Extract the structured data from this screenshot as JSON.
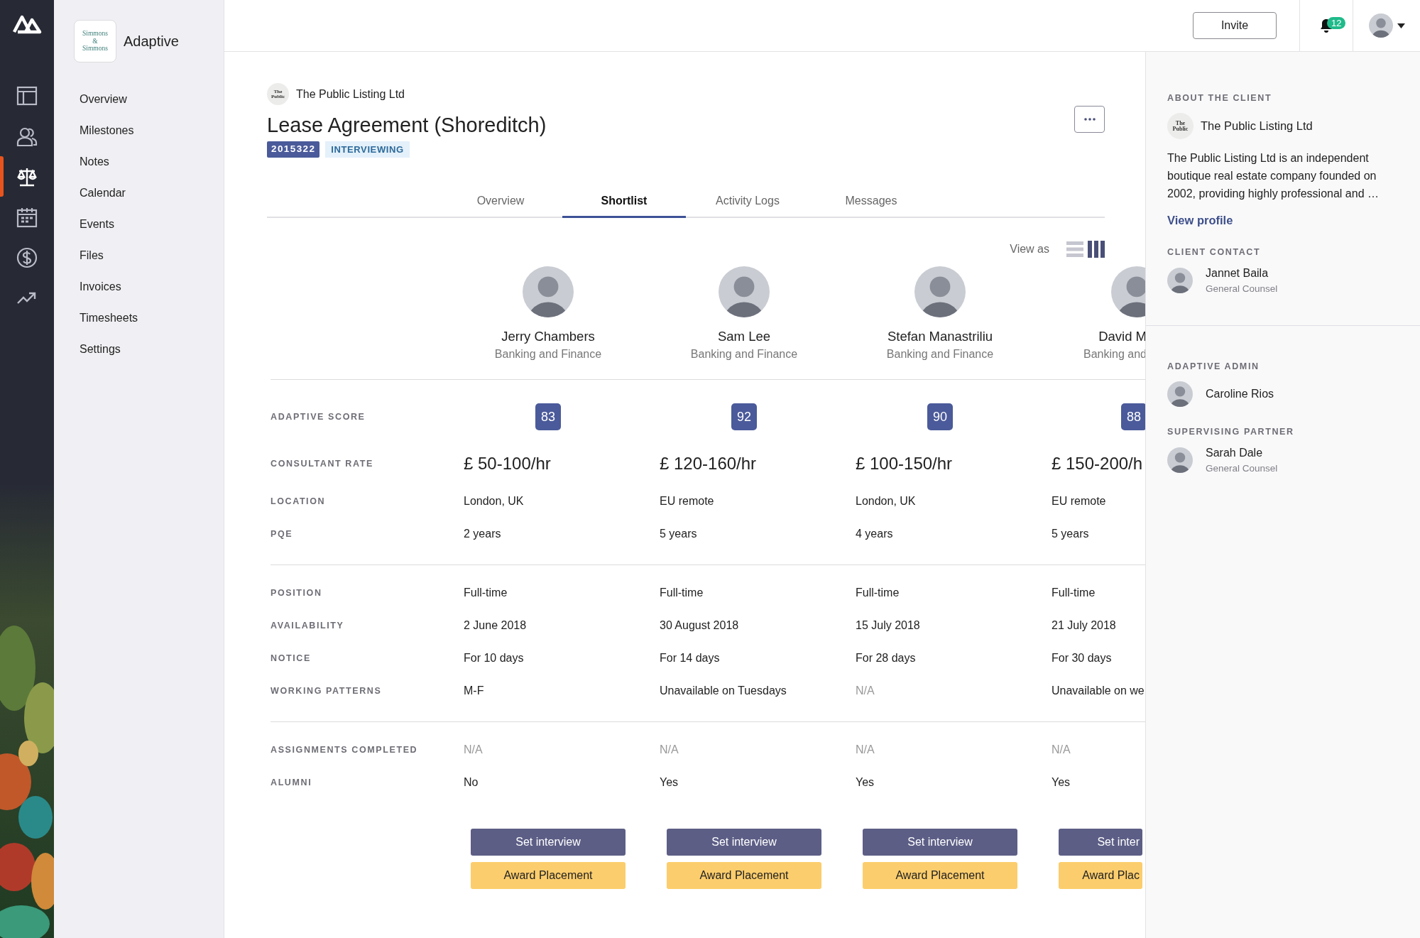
{
  "rail": {
    "items": [
      {
        "kind": "layout",
        "selected": false
      },
      {
        "kind": "people",
        "selected": false
      },
      {
        "kind": "scales",
        "selected": true
      },
      {
        "kind": "calendar",
        "selected": false
      },
      {
        "kind": "dollar",
        "selected": false
      },
      {
        "kind": "trend",
        "selected": false
      }
    ]
  },
  "sidebar": {
    "logo_text": "Simmons & Simmons",
    "org": "Adaptive",
    "items": [
      {
        "label": "Overview"
      },
      {
        "label": "Milestones"
      },
      {
        "label": "Notes"
      },
      {
        "label": "Calendar"
      },
      {
        "label": "Events"
      },
      {
        "label": "Files"
      },
      {
        "label": "Invoices"
      },
      {
        "label": "Timesheets"
      },
      {
        "label": "Settings"
      }
    ]
  },
  "topbar": {
    "invite": "Invite",
    "notifications": "12"
  },
  "header": {
    "client_logo_text": "The Public",
    "client": "The Public Listing Ltd",
    "title": "Lease Agreement (Shoreditch)",
    "id": "2015322",
    "status": "INTERVIEWING"
  },
  "tabs": [
    {
      "label": "Overview",
      "selected": false
    },
    {
      "label": "Shortlist",
      "selected": true
    },
    {
      "label": "Activity Logs",
      "selected": false
    },
    {
      "label": "Messages",
      "selected": false
    }
  ],
  "view_as": {
    "label": "View as",
    "options": [
      {
        "kind": "list",
        "selected": false
      },
      {
        "kind": "columns",
        "selected": true
      }
    ]
  },
  "candidates": [
    {
      "name": "Jerry Chambers",
      "practice": "Banking and Finance"
    },
    {
      "name": "Sam Lee",
      "practice": "Banking and Finance"
    },
    {
      "name": "Stefan Manastriliu",
      "practice": "Banking and Finance"
    },
    {
      "name": "David M",
      "practice": "Banking and"
    }
  ],
  "sections": [
    {
      "rows": [
        {
          "label": "ADAPTIVE SCORE",
          "kind": "score",
          "values": [
            {
              "text": "83"
            },
            {
              "text": "92"
            },
            {
              "text": "90"
            },
            {
              "text": "88"
            }
          ]
        },
        {
          "label": "CONSULTANT RATE",
          "kind": "rate",
          "values": [
            {
              "text": "£ 50-100/hr",
              "muted": false
            },
            {
              "text": "£ 120-160/hr",
              "muted": false
            },
            {
              "text": "£ 100-150/hr",
              "muted": false
            },
            {
              "text": "£ 150-200/h",
              "muted": false
            }
          ]
        },
        {
          "label": "LOCATION",
          "kind": "text",
          "values": [
            {
              "text": "London, UK",
              "muted": false
            },
            {
              "text": "EU remote",
              "muted": false
            },
            {
              "text": "London, UK",
              "muted": false
            },
            {
              "text": "EU remote",
              "muted": false
            }
          ]
        },
        {
          "label": "PQE",
          "kind": "text",
          "values": [
            {
              "text": "2 years",
              "muted": false
            },
            {
              "text": "5 years",
              "muted": false
            },
            {
              "text": "4 years",
              "muted": false
            },
            {
              "text": "5 years",
              "muted": false
            }
          ]
        }
      ]
    },
    {
      "rows": [
        {
          "label": "POSITION",
          "kind": "text",
          "values": [
            {
              "text": "Full-time",
              "muted": false
            },
            {
              "text": "Full-time",
              "muted": false
            },
            {
              "text": "Full-time",
              "muted": false
            },
            {
              "text": "Full-time",
              "muted": false
            }
          ]
        },
        {
          "label": "AVAILABILITY",
          "kind": "text",
          "values": [
            {
              "text": "2 June 2018",
              "muted": false
            },
            {
              "text": "30 August 2018",
              "muted": false
            },
            {
              "text": "15 July 2018",
              "muted": false
            },
            {
              "text": "21 July 2018",
              "muted": false
            }
          ]
        },
        {
          "label": "NOTICE",
          "kind": "text",
          "values": [
            {
              "text": "For 10 days",
              "muted": false
            },
            {
              "text": "For 14 days",
              "muted": false
            },
            {
              "text": "For 28 days",
              "muted": false
            },
            {
              "text": "For 30 days",
              "muted": false
            }
          ]
        },
        {
          "label": "WORKING PATTERNS",
          "kind": "text",
          "values": [
            {
              "text": "M-F",
              "muted": false
            },
            {
              "text": "Unavailable on Tuesdays",
              "muted": false
            },
            {
              "text": "N/A",
              "muted": true
            },
            {
              "text": "Unavailable on we",
              "muted": false
            }
          ]
        }
      ]
    },
    {
      "rows": [
        {
          "label": "ASSIGNMENTS COMPLETED",
          "kind": "text",
          "values": [
            {
              "text": "N/A",
              "muted": true
            },
            {
              "text": "N/A",
              "muted": true
            },
            {
              "text": "N/A",
              "muted": true
            },
            {
              "text": "N/A",
              "muted": true
            }
          ]
        },
        {
          "label": "ALUMNI",
          "kind": "text",
          "values": [
            {
              "text": "No",
              "muted": false
            },
            {
              "text": "Yes",
              "muted": false
            },
            {
              "text": "Yes",
              "muted": false
            },
            {
              "text": "Yes",
              "muted": false
            }
          ]
        }
      ]
    }
  ],
  "actions": [
    {
      "buttons": [
        {
          "kind": "primary",
          "label": "Set interview"
        },
        {
          "kind": "secondary",
          "label": "Award Placement"
        }
      ]
    },
    {
      "buttons": [
        {
          "kind": "primary",
          "label": "Set interview"
        },
        {
          "kind": "secondary",
          "label": "Award Placement"
        }
      ]
    },
    {
      "buttons": [
        {
          "kind": "primary",
          "label": "Set interview"
        },
        {
          "kind": "secondary",
          "label": "Award Placement"
        }
      ]
    },
    {
      "buttons": [
        {
          "kind": "primary",
          "label": "Set inter"
        },
        {
          "kind": "secondary",
          "label": "Award Plac"
        }
      ]
    }
  ],
  "panel": {
    "about": {
      "heading": "ABOUT THE CLIENT",
      "logo_text": "The Public",
      "name": "The Public Listing Ltd",
      "description": "The Public Listing Ltd is an independent boutique real estate company founded on 2002, providing highly professional and …",
      "link": "View profile"
    },
    "groups": [
      {
        "sections": [
          {
            "heading": "CLIENT CONTACT",
            "people": [
              {
                "name": "Jannet Baila",
                "role": "General Counsel"
              }
            ]
          }
        ]
      },
      {
        "sections": [
          {
            "heading": "ADAPTIVE ADMIN",
            "people": [
              {
                "name": "Caroline Rios"
              }
            ]
          },
          {
            "heading": "SUPERVISING PARTNER",
            "people": [
              {
                "name": "Sarah Dale",
                "role": "General Counsel"
              }
            ]
          }
        ]
      }
    ]
  }
}
